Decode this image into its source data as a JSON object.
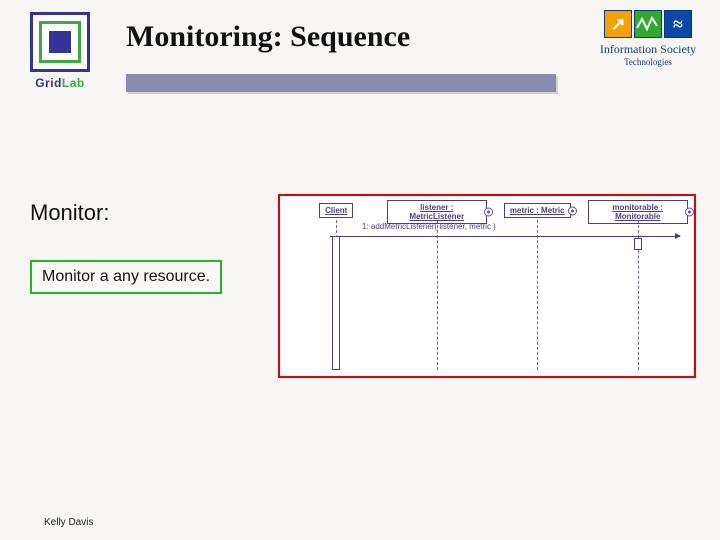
{
  "header": {
    "title": "Monitoring: Sequence",
    "gridlab": {
      "text_a": "Grid",
      "text_b": "Lab"
    },
    "ist": {
      "b1": "↗",
      "b3": "≈",
      "line1": "Information Society",
      "line2": "Technologies"
    }
  },
  "body": {
    "section_label": "Monitor:",
    "caption": "Monitor a any resource."
  },
  "sequence": {
    "participants": [
      {
        "label": "Client",
        "ring": false
      },
      {
        "label": "listener : MetricListener",
        "ring": true
      },
      {
        "label": "metric : Metric",
        "ring": true
      },
      {
        "label": "monitorable : Monitorable",
        "ring": true
      }
    ],
    "message1": "1: addMetricListener( listener, metric )"
  },
  "footer": {
    "author": "Kelly Davis"
  }
}
